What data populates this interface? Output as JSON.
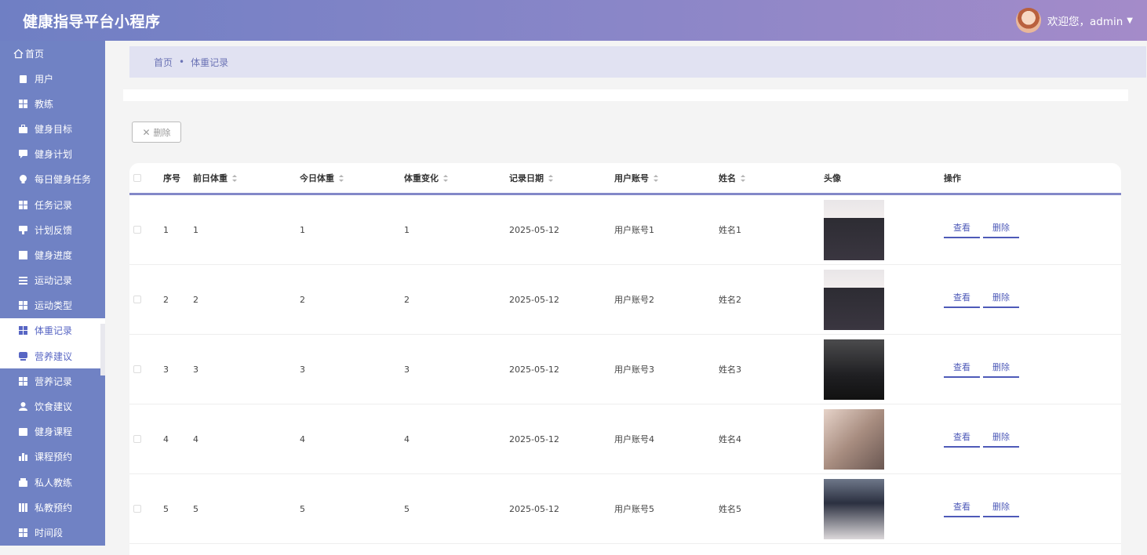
{
  "header": {
    "title": "健康指导平台小程序",
    "welcome": "欢迎您，admin"
  },
  "sidebar": {
    "home": "首页",
    "items": [
      {
        "label": "用户",
        "icon": "clipboard-icon"
      },
      {
        "label": "教练",
        "icon": "grid-icon"
      },
      {
        "label": "健身目标",
        "icon": "briefcase-icon"
      },
      {
        "label": "健身计划",
        "icon": "chat-icon"
      },
      {
        "label": "每日健身任务",
        "icon": "bulb-icon"
      },
      {
        "label": "任务记录",
        "icon": "grid-icon"
      },
      {
        "label": "计划反馈",
        "icon": "feedback-icon"
      },
      {
        "label": "健身进度",
        "icon": "table-icon"
      },
      {
        "label": "运动记录",
        "icon": "list-icon"
      },
      {
        "label": "运动类型",
        "icon": "grid-icon"
      },
      {
        "label": "体重记录",
        "icon": "grid-icon"
      },
      {
        "label": "营养建议",
        "icon": "monitor-icon"
      },
      {
        "label": "营养记录",
        "icon": "grid-icon"
      },
      {
        "label": "饮食建议",
        "icon": "user-icon"
      },
      {
        "label": "健身课程",
        "icon": "calendar-icon"
      },
      {
        "label": "课程预约",
        "icon": "bar-chart-icon"
      },
      {
        "label": "私人教练",
        "icon": "wallet-icon"
      },
      {
        "label": "私教预约",
        "icon": "columns-icon"
      },
      {
        "label": "时间段",
        "icon": "grid-icon"
      }
    ]
  },
  "breadcrumb": {
    "home": "首页",
    "sep": "•",
    "current": "体重记录"
  },
  "toolbar": {
    "delete_label": "删除"
  },
  "table": {
    "headers": {
      "index": "序号",
      "prev_weight": "前日体重",
      "today_weight": "今日体重",
      "change": "体重变化",
      "date": "记录日期",
      "account": "用户账号",
      "name": "姓名",
      "avatar": "头像",
      "actions": "操作"
    },
    "view_label": "查看",
    "delete_label": "删除",
    "rows": [
      {
        "index": "1",
        "prev": "1",
        "today": "1",
        "change": "1",
        "date": "2025-05-12",
        "account": "用户账号1",
        "name": "姓名1"
      },
      {
        "index": "2",
        "prev": "2",
        "today": "2",
        "change": "2",
        "date": "2025-05-12",
        "account": "用户账号2",
        "name": "姓名2"
      },
      {
        "index": "3",
        "prev": "3",
        "today": "3",
        "change": "3",
        "date": "2025-05-12",
        "account": "用户账号3",
        "name": "姓名3"
      },
      {
        "index": "4",
        "prev": "4",
        "today": "4",
        "change": "4",
        "date": "2025-05-12",
        "account": "用户账号4",
        "name": "姓名4"
      },
      {
        "index": "5",
        "prev": "5",
        "today": "5",
        "change": "5",
        "date": "2025-05-12",
        "account": "用户账号5",
        "name": "姓名5"
      }
    ]
  },
  "colors": {
    "header_start": "#6f7fc4",
    "header_end": "#a48bc9",
    "sidebar": "#7082c4",
    "accent": "#4e5ab8"
  }
}
